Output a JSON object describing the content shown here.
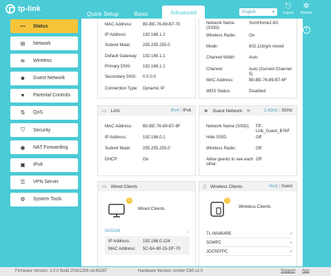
{
  "header": {
    "logo_text": "tp-link",
    "tabs": [
      "Quick Setup",
      "Basic",
      "Advanced"
    ],
    "language": "English",
    "logout_label": "Logout",
    "reboot_label": "Reboot"
  },
  "sidebar": {
    "items": [
      {
        "label": "Status",
        "icon": "pulse-icon"
      },
      {
        "label": "Network",
        "icon": "network-icon"
      },
      {
        "label": "Wireless",
        "icon": "wireless-icon"
      },
      {
        "label": "Guest Network",
        "icon": "guest-network-icon"
      },
      {
        "label": "Parental Controls",
        "icon": "parental-controls-icon"
      },
      {
        "label": "QoS",
        "icon": "qos-icon"
      },
      {
        "label": "Security",
        "icon": "security-shield-icon"
      },
      {
        "label": "NAT Forwarding",
        "icon": "nat-forwarding-icon"
      },
      {
        "label": "IPv6",
        "icon": "ipv6-icon"
      },
      {
        "label": "VPN Server",
        "icon": "vpn-icon"
      },
      {
        "label": "System Tools",
        "icon": "system-tools-icon"
      }
    ]
  },
  "internet": {
    "rows": [
      {
        "k": "MAC Address:",
        "v": "B0-BE-76-89-B7-70"
      },
      {
        "k": "IP Address:",
        "v": "192.168.1.2"
      },
      {
        "k": "Subnet Mask:",
        "v": "255.255.255.0"
      },
      {
        "k": "Default Gateway:",
        "v": "192.168.1.1"
      },
      {
        "k": "Primary DNS:",
        "v": "192.168.1.1"
      },
      {
        "k": "Secondary DNS:",
        "v": "0.0.0.0"
      },
      {
        "k": "Connection Type:",
        "v": "Dynamic IP"
      }
    ]
  },
  "wireless_top": {
    "rows": [
      {
        "k": "Network Name (SSID):",
        "v": "SomHome2.4G"
      },
      {
        "k": "Wireless Radio:",
        "v": "On"
      },
      {
        "k": "Mode:",
        "v": "802.11b/g/n mixed"
      },
      {
        "k": "Channel Width:",
        "v": "Auto"
      },
      {
        "k": "Channel:",
        "v": "Auto (Current Channel 5)"
      },
      {
        "k": "MAC Address:",
        "v": "B0-BE-76-89-B7-6F"
      },
      {
        "k": "WDS Status:",
        "v": "Disabled"
      }
    ]
  },
  "lan": {
    "title": "LAN",
    "tab_ipv4": "IPv4",
    "tab_ipv6": "IPv6",
    "rows": [
      {
        "k": "MAC Address:",
        "v": "B0-BE-76-89-B7-6F"
      },
      {
        "k": "IP Address:",
        "v": "192.168.0.1"
      },
      {
        "k": "Subnet Mask:",
        "v": "255.255.255.0"
      },
      {
        "k": "DHCP:",
        "v": "On"
      }
    ]
  },
  "guest": {
    "title": "Guest Network",
    "band_24": "2.4GHz",
    "band_5": "5GHz",
    "rows": [
      {
        "k": "Network Name (SSID):",
        "v": "TP-Link_Guest_B76F"
      },
      {
        "k": "Hide SSID:",
        "v": "Off"
      },
      {
        "k": "Wireless Radio:",
        "v": "Off"
      },
      {
        "k": "Allow guests to see each other:",
        "v": "Off"
      }
    ]
  },
  "wired_clients": {
    "title": "Wired Clients",
    "count": "1",
    "label": "Wired Clients",
    "device_name": "NAS326",
    "ip_label": "IP Address:",
    "ip_value": "192.168.0.124",
    "mac_label": "MAC Address:",
    "mac_value": "5C-6A-80-15-DF-70"
  },
  "wireless_clients": {
    "title": "Wireless Clients",
    "tab_host": "Host",
    "tab_guest": "Guest",
    "count": "3",
    "label": "Wireless Clients",
    "devices": [
      "TL-WA854RE",
      "SOMPC",
      "JOZSEFPC"
    ]
  },
  "footer": {
    "firmware": "Firmware Version: 2.0.0 Build 20161206 rel.60287",
    "hardware": "Hardware Version: Archer C60 v2.0",
    "support": "Support",
    "app": "App"
  },
  "colors": {
    "accent": "#4acbd6",
    "active_menu": "#f8c53a",
    "badge": "#f8c53a"
  }
}
